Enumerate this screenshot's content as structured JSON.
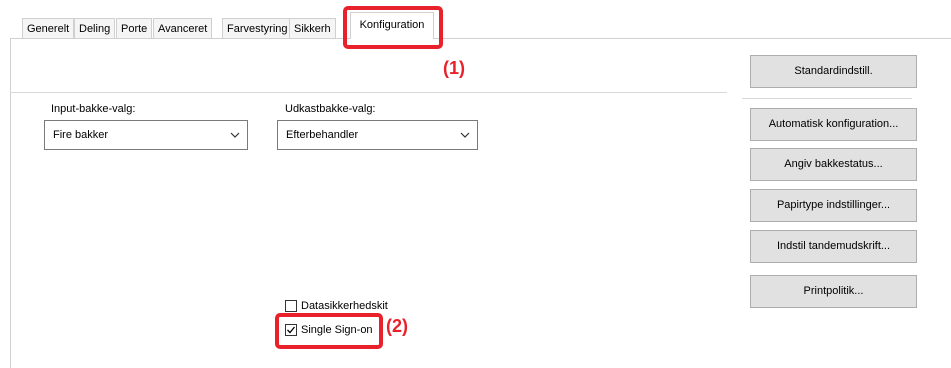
{
  "tabs": [
    {
      "label": "Generelt"
    },
    {
      "label": "Deling"
    },
    {
      "label": "Porte"
    },
    {
      "label": "Avanceret"
    },
    {
      "label": "Farvestyring"
    },
    {
      "label": "Sikkerh"
    },
    {
      "label": "Konfiguration",
      "active": true
    }
  ],
  "input_tray": {
    "label": "Input-bakke-valg:",
    "value": "Fire bakker"
  },
  "output_tray": {
    "label": "Udkastbakke-valg:",
    "value": "Efterbehandler"
  },
  "buttons": {
    "default": "Standardindstill.",
    "auto_config": "Automatisk konfiguration...",
    "tray_status": "Angiv bakkestatus...",
    "paper_type": "Papirtype indstillinger...",
    "tandem": "Indstil tandemudskrift...",
    "print_policy": "Printpolitik..."
  },
  "checkboxes": {
    "data_security": {
      "label": "Datasikkerhedskit",
      "checked": false
    },
    "single_sign_on": {
      "label": "Single Sign-on",
      "checked": true
    }
  },
  "callouts": {
    "one": "(1)",
    "two": "(2)"
  },
  "colors": {
    "highlight": "#e8212b"
  }
}
